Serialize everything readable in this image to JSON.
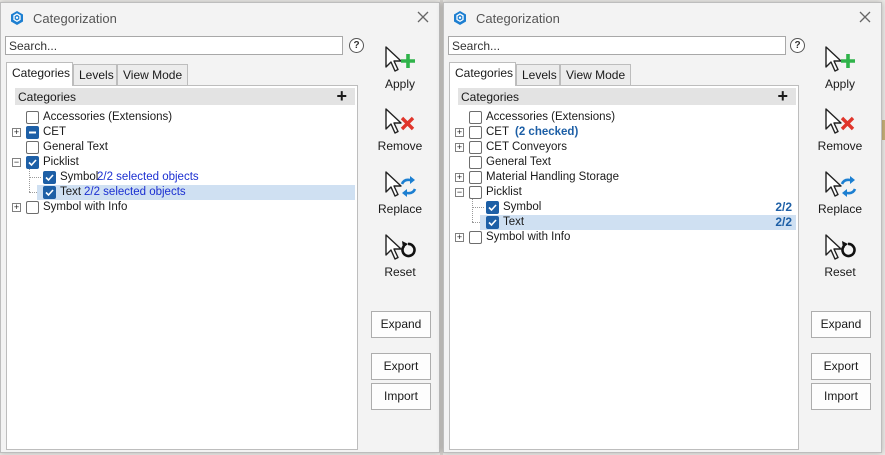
{
  "dialog_left": {
    "title": "Categorization",
    "search": {
      "placeholder": "Search..."
    },
    "help": "?",
    "tabs": [
      "Categories",
      "Levels",
      "View Mode"
    ],
    "tree_header": "Categories",
    "tree": [
      {
        "label": "Accessories (Extensions)",
        "info": ""
      },
      {
        "label": "CET",
        "info": ""
      },
      {
        "label": "General Text",
        "info": ""
      },
      {
        "label": "Picklist",
        "info": ""
      },
      {
        "label": "Symbol",
        "info": "2/2 selected objects"
      },
      {
        "label": "Text",
        "info": "2/2 selected objects"
      },
      {
        "label": "Symbol with Info",
        "info": ""
      }
    ],
    "actions": {
      "apply": "Apply",
      "remove": "Remove",
      "replace": "Replace",
      "reset": "Reset"
    },
    "buttons": {
      "expand": "Expand",
      "export": "Export",
      "import": "Import"
    }
  },
  "dialog_right": {
    "title": "Categorization",
    "search": {
      "placeholder": "Search..."
    },
    "help": "?",
    "tabs": [
      "Categories",
      "Levels",
      "View Mode"
    ],
    "tree_header": "Categories",
    "tree": [
      {
        "label": "Accessories (Extensions)",
        "info": ""
      },
      {
        "label": "CET",
        "info": "(2 checked)"
      },
      {
        "label": "CET Conveyors",
        "info": ""
      },
      {
        "label": "General Text",
        "info": ""
      },
      {
        "label": "Material Handling Storage",
        "info": ""
      },
      {
        "label": "Picklist",
        "info": ""
      },
      {
        "label": "Symbol",
        "info": "2/2"
      },
      {
        "label": "Text",
        "info": "2/2"
      },
      {
        "label": "Symbol with Info",
        "info": ""
      }
    ],
    "actions": {
      "apply": "Apply",
      "remove": "Remove",
      "replace": "Replace",
      "reset": "Reset"
    },
    "buttons": {
      "expand": "Expand",
      "export": "Export",
      "import": "Import"
    }
  },
  "colors": {
    "accent": "#1d5fa6",
    "info_blue": "#1b2fd1",
    "selection": "#cfe0f2",
    "apply_plus": "#2fb34a",
    "remove_x": "#e0352b",
    "replace_arrows": "#1c7fd1"
  },
  "icons": [
    "app-hex-icon",
    "close-icon",
    "help-icon",
    "cursor-plus-icon",
    "cursor-x-icon",
    "cursor-swap-icon",
    "cursor-reset-icon",
    "expander-plus-icon",
    "expander-minus-icon",
    "checkbox-icon"
  ]
}
